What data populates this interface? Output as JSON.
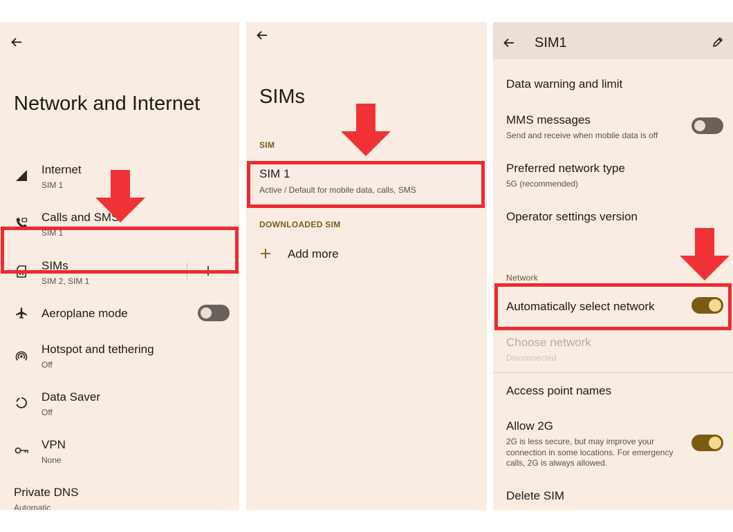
{
  "screen1": {
    "title": "Network and Internet",
    "items": [
      {
        "label": "Internet",
        "sub": "SIM 1"
      },
      {
        "label": "Calls and SMS",
        "sub": "SIM 1"
      },
      {
        "label": "SIMs",
        "sub": "SIM 2, SIM 1"
      },
      {
        "label": "Aeroplane mode",
        "sub": ""
      },
      {
        "label": "Hotspot and tethering",
        "sub": "Off"
      },
      {
        "label": "Data Saver",
        "sub": "Off"
      },
      {
        "label": "VPN",
        "sub": "None"
      },
      {
        "label": "Private DNS",
        "sub": "Automatic"
      }
    ],
    "aeroplane_toggle": "off"
  },
  "screen2": {
    "title": "SIMs",
    "section_sim": "SIM",
    "sim1": {
      "label": "SIM 1",
      "sub": "Active / Default for mobile data, calls, SMS"
    },
    "section_downloaded": "DOWNLOADED SIM",
    "add_more": "Add more"
  },
  "screen3": {
    "title": "SIM1",
    "items": [
      {
        "label": "Data warning and limit",
        "sub": ""
      },
      {
        "label": "MMS messages",
        "sub": "Send and receive when mobile data is off"
      },
      {
        "label": "Preferred network type",
        "sub": "5G (recommended)"
      },
      {
        "label": "Operator settings version",
        "sub": ""
      }
    ],
    "section_network": "Network",
    "auto_select": "Automatically select network",
    "choose_network": {
      "label": "Choose network",
      "sub": "Disconnected"
    },
    "apn": "Access point names",
    "allow2g": {
      "label": "Allow 2G",
      "desc": "2G is less secure, but may improve your connection in some locations. For emergency calls, 2G is always allowed."
    },
    "delete_sim": "Delete SIM",
    "toggles": {
      "mms": "off",
      "auto_select": "on",
      "allow2g": "on"
    }
  },
  "colors": {
    "highlight": "#ee2a2f",
    "toggle_on": "#7b5a11",
    "toggle_off": "#6a615a",
    "panel_bg": "#f9ece3"
  },
  "icons": [
    "back-arrow-icon",
    "signal-icon",
    "calls-icon",
    "sim-card-icon",
    "plus-icon",
    "airplane-icon",
    "hotspot-icon",
    "data-saver-icon",
    "vpn-key-icon",
    "edit-pencil-icon",
    "red-arrow-icon"
  ]
}
